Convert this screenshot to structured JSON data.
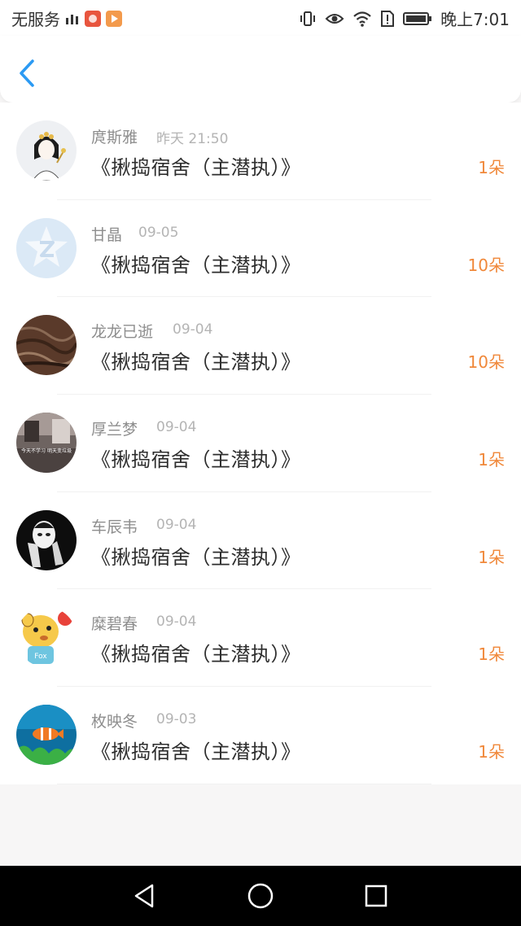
{
  "status_bar": {
    "carrier": "无服务",
    "time": "晚上7:01"
  },
  "nav": {
    "back_icon": "chevron-left-icon"
  },
  "list": {
    "items": [
      {
        "name": "庹斯雅",
        "date": "昨天 21:50",
        "title": "《揪捣宿舍（主潜执）》",
        "count": "1朵"
      },
      {
        "name": "甘晶",
        "date": "09-05",
        "title": "《揪捣宿舍（主潜执）》",
        "count": "10朵"
      },
      {
        "name": "龙龙已逝",
        "date": "09-04",
        "title": "《揪捣宿舍（主潜执）》",
        "count": "10朵"
      },
      {
        "name": "厚兰梦",
        "date": "09-04",
        "title": "《揪捣宿舍（主潜执）》",
        "count": "1朵"
      },
      {
        "name": "车辰韦",
        "date": "09-04",
        "title": "《揪捣宿舍（主潜执）》",
        "count": "1朵"
      },
      {
        "name": "糜碧春",
        "date": "09-04",
        "title": "《揪捣宿舍（主潜执）》",
        "count": "1朵"
      },
      {
        "name": "枚映冬",
        "date": "09-03",
        "title": "《揪捣宿舍（主潜执）》",
        "count": "1朵"
      }
    ],
    "avatar_text_3": "今天不学习 明天变垃圾",
    "avatar_text_6": "Fox"
  },
  "colors": {
    "accent_blue": "#2b9af3",
    "count_orange": "#f0883a"
  }
}
